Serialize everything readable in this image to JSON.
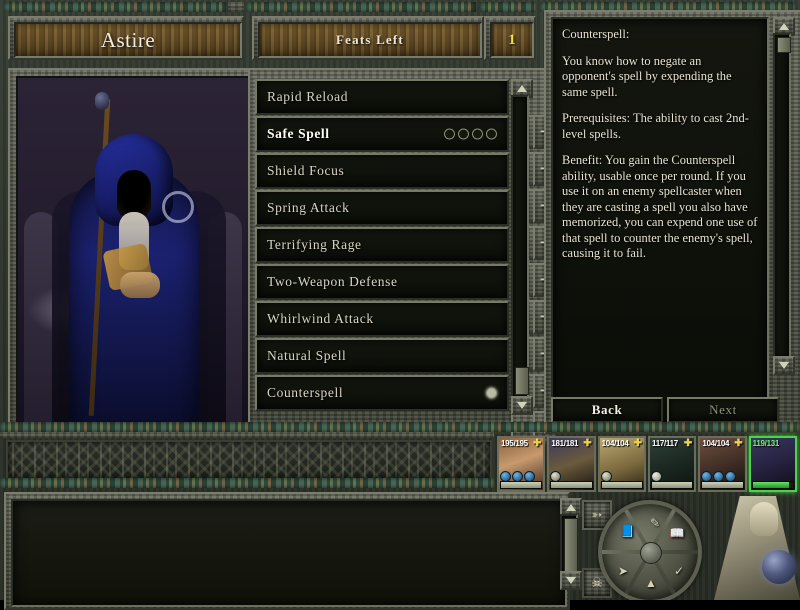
{
  "header": {
    "character_name": "Astire",
    "feats_left_label": "Feats Left",
    "feats_left_value": "1"
  },
  "feats_list": {
    "rows": [
      {
        "label": "Rapid Reload",
        "pips": 0,
        "selected": false
      },
      {
        "label": "Safe Spell",
        "pips": 4,
        "selected": true
      },
      {
        "label": "Shield Focus",
        "pips": 0,
        "selected": false
      },
      {
        "label": "Spring Attack",
        "pips": 0,
        "selected": false
      },
      {
        "label": "Terrifying Rage",
        "pips": 0,
        "selected": false
      },
      {
        "label": "Two-Weapon Defense",
        "pips": 0,
        "selected": false
      },
      {
        "label": "Whirlwind Attack",
        "pips": 0,
        "selected": false
      },
      {
        "label": "Natural Spell",
        "pips": 0,
        "selected": false
      },
      {
        "label": "Counterspell",
        "pips": 1,
        "selected": false
      }
    ],
    "add_label": "+",
    "remove_label": "−"
  },
  "description": {
    "title": "Counterspell:",
    "paragraphs": [
      "You know how to negate an opponent's spell by expending the same spell.",
      "Prerequisites: The ability to cast 2nd-level spells.",
      "Benefit: You gain the Counterspell ability, usable once per round. If you use it on an enemy spellcaster when they are casting a spell you also have memorized, you can expend one use of that spell to counter the enemy's spell, causing it to fail."
    ]
  },
  "navigation": {
    "back_label": "Back",
    "next_label": "Next"
  },
  "party": [
    {
      "hp": "195/195",
      "hp_current": 195,
      "hp_max": 195,
      "selected": false,
      "statuses": 3
    },
    {
      "hp": "181/181",
      "hp_current": 181,
      "hp_max": 181,
      "selected": false,
      "statuses": 1
    },
    {
      "hp": "104/104",
      "hp_current": 104,
      "hp_max": 104,
      "selected": false,
      "statuses": 1
    },
    {
      "hp": "117/117",
      "hp_current": 117,
      "hp_max": 117,
      "selected": false,
      "statuses": 1
    },
    {
      "hp": "104/104",
      "hp_current": 104,
      "hp_max": 104,
      "selected": false,
      "statuses": 3
    },
    {
      "hp": "119/131",
      "hp_current": 119,
      "hp_max": 131,
      "selected": true,
      "statuses": 0
    }
  ],
  "radial_menu": {
    "icons": [
      "journal-icon",
      "quill-icon",
      "spellbook-icon",
      "check-icon",
      "map-icon",
      "arrow-icon"
    ]
  },
  "side_icons": [
    "cursor-icon",
    "skull-icon"
  ],
  "colors": {
    "accent_yellow": "#f2e43a",
    "selected_green": "#4cd24c",
    "text_light": "#e7e2d2",
    "stone": "#575a4d"
  }
}
